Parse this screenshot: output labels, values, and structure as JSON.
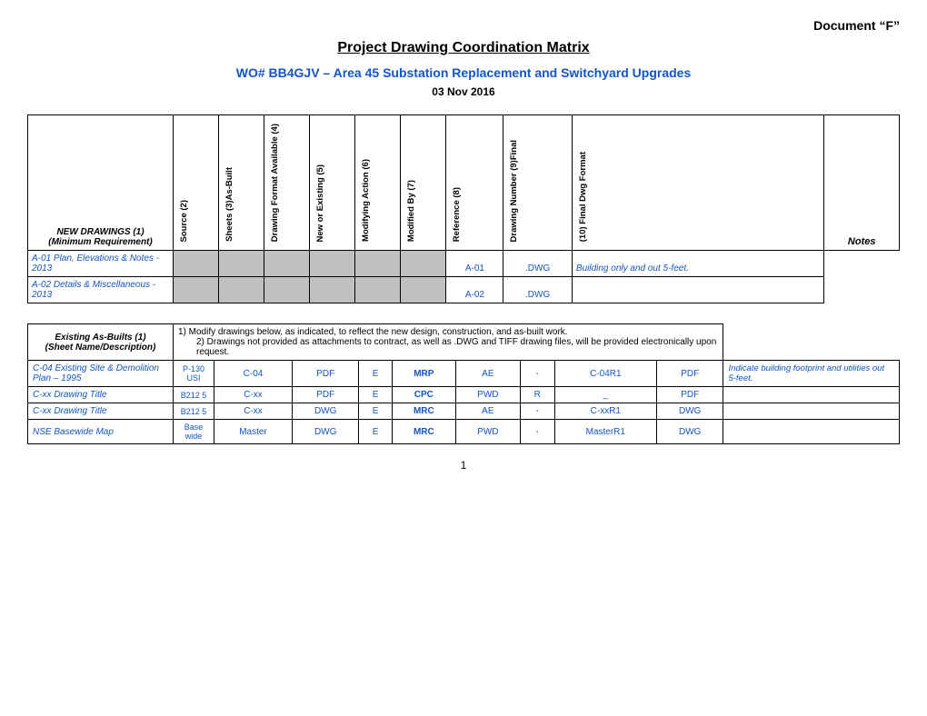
{
  "doc_label": "Document “F”",
  "page_title": "Project Drawing Coordination Matrix",
  "subtitle": "WO# BB4GJV – Area 45 Substation Replacement and Switchyard Upgrades",
  "date": "03 Nov 2016",
  "top_table": {
    "left_header_line1": "NEW DRAWINGS (1)",
    "left_header_line2": "(Minimum Requirement)",
    "col_headers": [
      "Source (2)",
      "Sheets (3)As-Built",
      "Drawing Format Available (4)",
      "New or Existing (5)",
      "Modifying Action (6)",
      "Modified By (7)",
      "Reference (8)",
      "Drawing Number (9)Final",
      "(10) Final Dwg Format",
      "Notes"
    ],
    "rows": [
      {
        "name": "A-01 Plan, Elevations & Notes - 2013",
        "source": "",
        "sheets": "",
        "format": "",
        "new_existing": "",
        "mod_action": "",
        "modified_by": "",
        "reference": "A-01",
        "drawing_number": ".DWG",
        "note": "Building only and out 5-feet.",
        "gray_cols": [
          0,
          1,
          2,
          3,
          4,
          5
        ]
      },
      {
        "name": "A-02 Details & Miscellaneous - 2013",
        "source": "",
        "sheets": "",
        "format": "",
        "new_existing": "",
        "mod_action": "",
        "modified_by": "",
        "reference": "A-02",
        "drawing_number": ".DWG",
        "note": "",
        "gray_cols": [
          0,
          1,
          2,
          3,
          4,
          5
        ]
      }
    ]
  },
  "bottom_table": {
    "left_header_line1": "Existing As-Builts (1)",
    "left_header_line2": "(Sheet Name/Description)",
    "instructions": [
      "1)   Modify drawings below, as indicated, to reflect the new design, construction, and as-built work.",
      "2)   Drawings not provided as attachments to contract, as well as .DWG and TIFF drawing files, will be provided electronically upon request."
    ],
    "rows": [
      {
        "name": "C-04  Existing Site & Demolition Plan – 1995",
        "source": "P-130 USI",
        "sheets": "C-04",
        "format": "PDF",
        "new_existing": "E",
        "mod_action": "MRP",
        "modified_by": "AE",
        "reference": "-",
        "drawing_number": "C-04R1",
        "final_format": "PDF",
        "note": "Indicate building footprint and utilities out 5-feet."
      },
      {
        "name": "C-xx  Drawing Title",
        "source": "B212 5",
        "sheets": "C-xx",
        "format": "PDF",
        "new_existing": "E",
        "mod_action": "CPC",
        "modified_by": "PWD",
        "reference": "R",
        "drawing_number": "_",
        "final_format": "PDF",
        "note": ""
      },
      {
        "name": "C-xx  Drawing Title",
        "source": "B212 5",
        "sheets": "C-xx",
        "format": "DWG",
        "new_existing": "E",
        "mod_action": "MRC",
        "modified_by": "AE",
        "reference": "-",
        "drawing_number": "C-xxR1",
        "final_format": "DWG",
        "note": ""
      },
      {
        "name": "NSE Basewide Map",
        "source": "Base wide",
        "sheets": "Master",
        "format": "DWG",
        "new_existing": "E",
        "mod_action": "MRC",
        "modified_by": "PWD",
        "reference": "-",
        "drawing_number": "MasterR1",
        "final_format": "DWG",
        "note": ""
      }
    ]
  },
  "page_number": "1"
}
